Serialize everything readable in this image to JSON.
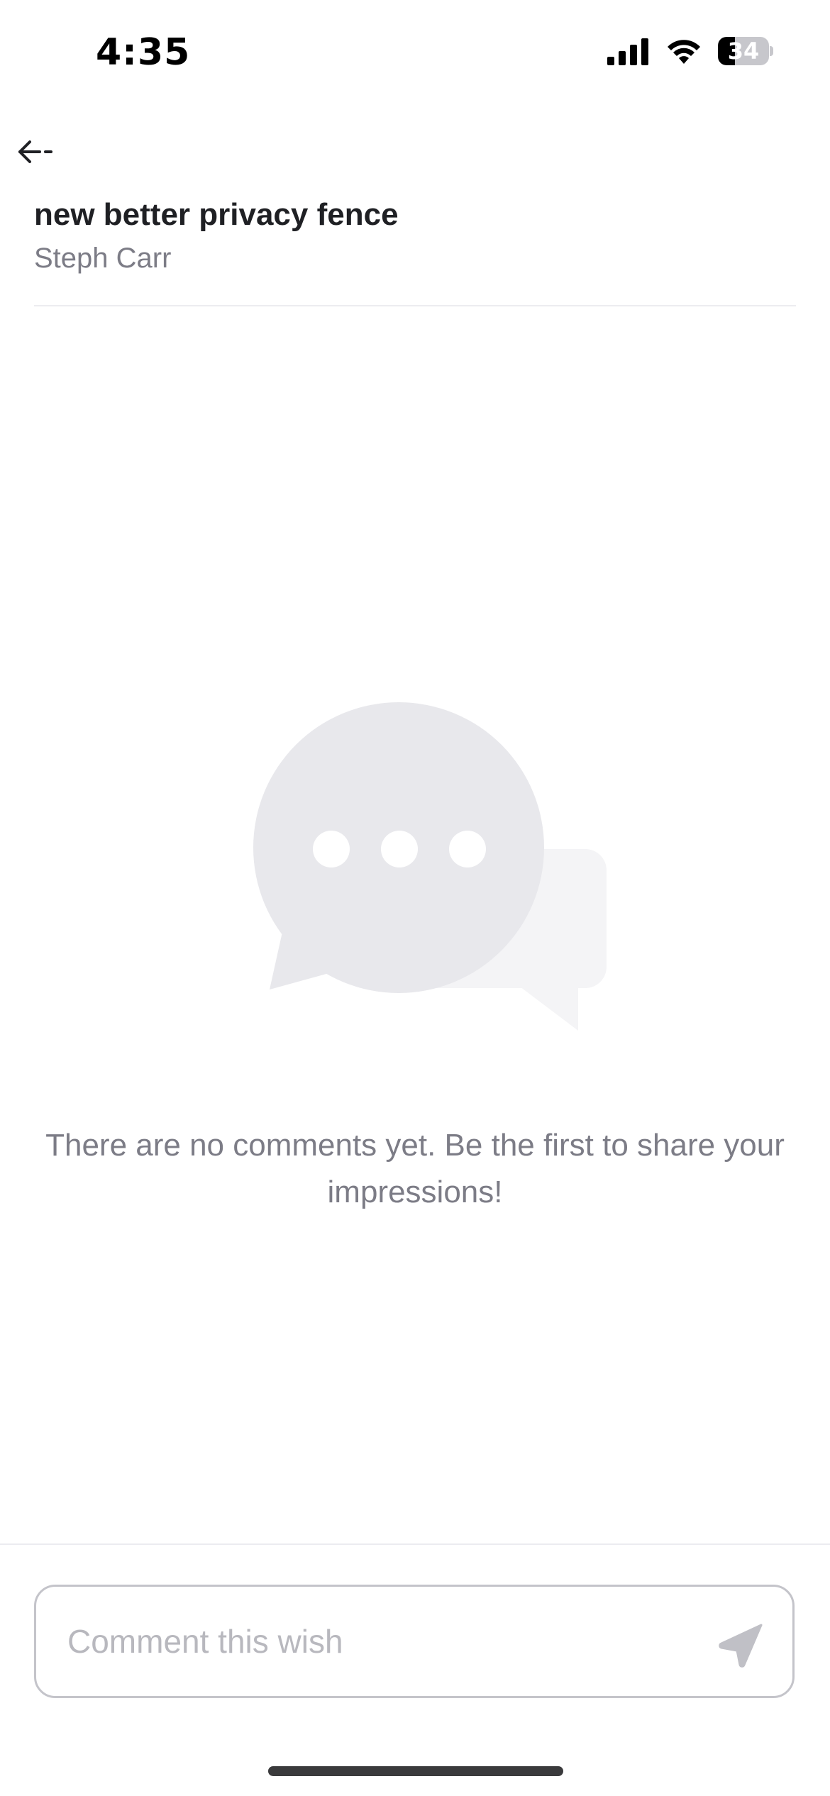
{
  "status_bar": {
    "time": "4:35",
    "battery_level": "34",
    "battery_fraction": 0.34,
    "icons": [
      "signal-icon",
      "wifi-icon",
      "battery-icon"
    ]
  },
  "header": {
    "back_icon": "back-arrow-icon",
    "title": "new better privacy fence",
    "author": "Steph Carr"
  },
  "empty_state": {
    "illustration": "chat-bubbles-icon",
    "message": "There are no comments yet. Be the first to share your impressions!"
  },
  "composer": {
    "placeholder": "Comment this wish",
    "value": "",
    "send_icon": "send-icon"
  },
  "colors": {
    "text_primary": "#1f2024",
    "text_secondary": "#7c7c86",
    "placeholder": "#b8b8be",
    "bubble_main": "#e8e8ec",
    "bubble_back": "#f4f4f6",
    "send_icon": "#c0c0c6"
  }
}
